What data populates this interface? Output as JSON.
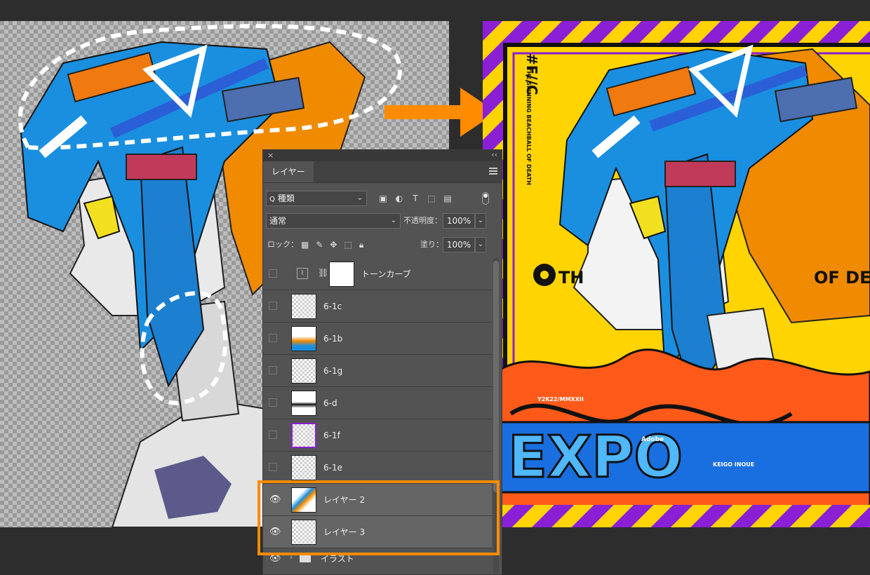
{
  "panel": {
    "close_glyph": "×",
    "collapse_glyph": "‹‹",
    "tab_label": "レイヤー",
    "filter": {
      "search_glyph": "Q",
      "kind_label": "種類"
    },
    "blend_mode": "通常",
    "opacity_label": "不透明度：",
    "opacity_value": "100%",
    "lock_label": "ロック：",
    "fill_label": "塗り：",
    "fill_value": "100%",
    "layers": [
      {
        "name": "トーンカーブ",
        "visible": false,
        "type": "adjustment"
      },
      {
        "name": "6-1c",
        "visible": false
      },
      {
        "name": "6-1b",
        "visible": false
      },
      {
        "name": "6-1g",
        "visible": false
      },
      {
        "name": "6-d",
        "visible": false
      },
      {
        "name": "6-1f",
        "visible": false
      },
      {
        "name": "6-1e",
        "visible": false
      },
      {
        "name": "レイヤー 2",
        "visible": true,
        "highlighted": true
      },
      {
        "name": "レイヤー 3",
        "visible": true,
        "highlighted": true
      },
      {
        "name": "イラスト",
        "visible": true,
        "type": "group"
      }
    ]
  },
  "artwork": {
    "hash_tag": "#F//C",
    "vertical_caption": "THE SPINNING BEACHBALL OF DEATH",
    "left_text": "TH",
    "right_text": "OF DE",
    "date_text": "Y2K22/MMXXII",
    "logo_text": "EXPO",
    "adobe_text": "Adobe",
    "artist_text": "KEIGO INOUE"
  },
  "colors": {
    "highlight_box": "#ff8c00",
    "arrow": "#ff8c00",
    "poster_yellow": "#ffd400",
    "poster_purple": "#8b1fd6",
    "hair_blue": "#1a8fe0",
    "hair_orange": "#f08a00"
  }
}
